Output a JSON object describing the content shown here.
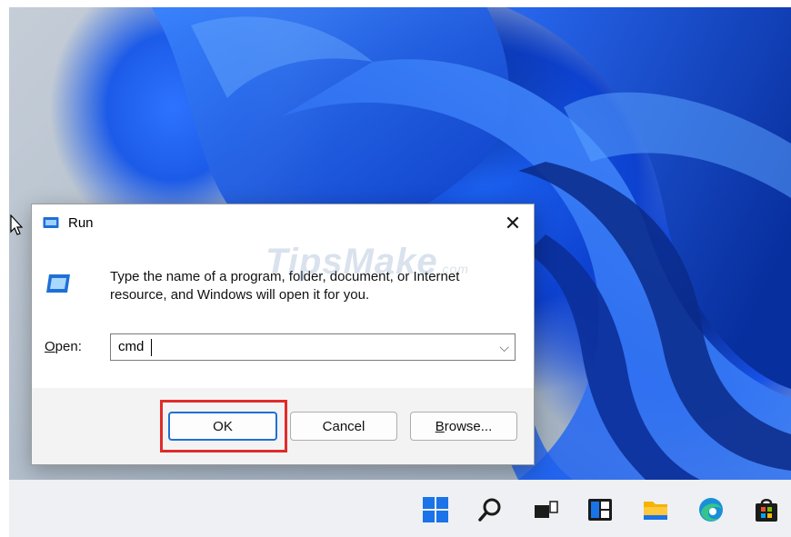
{
  "window": {
    "title": "Run",
    "close_glyph": "✕"
  },
  "dialog": {
    "description_line1": "Type the name of a program, folder, document, or Internet",
    "description_line2": "resource, and Windows will open it for you.",
    "open_label_first": "O",
    "open_label_rest": "pen:",
    "open_value": "cmd",
    "dropdown_glyph": "⌵"
  },
  "buttons": {
    "ok": "OK",
    "cancel": "Cancel",
    "browse_first": "B",
    "browse_rest": "rowse..."
  },
  "watermark": {
    "text": "TipsMake",
    "suffix": ".com"
  },
  "taskbar": {
    "icons": [
      "windows-start-icon",
      "search-icon",
      "task-view-icon",
      "widgets-icon",
      "file-explorer-icon",
      "edge-browser-icon",
      "microsoft-store-icon"
    ]
  },
  "colors": {
    "accent": "#1f6fd6",
    "highlight": "#e02b2b",
    "wallpaper_blue": "#1650e6"
  }
}
